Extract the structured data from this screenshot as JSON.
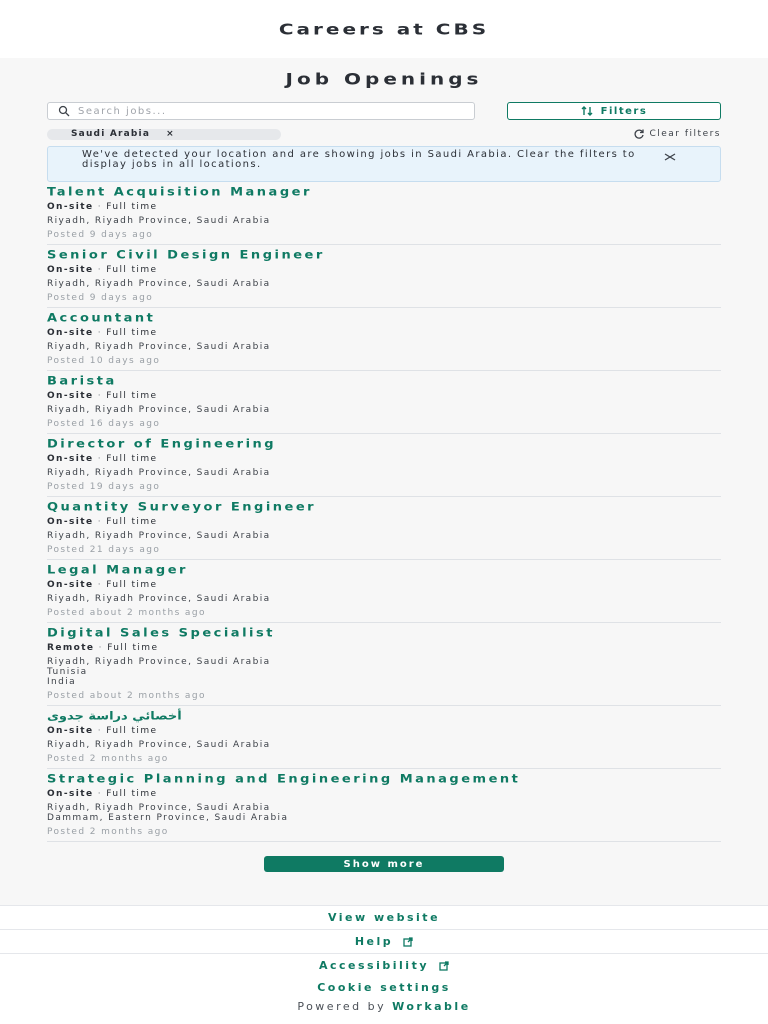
{
  "header": {
    "title": "Careers at CBS"
  },
  "main": {
    "title": "Job Openings",
    "search": {
      "placeholder": "Search jobs..."
    },
    "filters_label": "Filters",
    "filter_chip": {
      "label": "Saudi Arabia",
      "close": "×"
    },
    "clear_filters_label": "Clear filters",
    "notice": {
      "text": "We've detected your location and are showing jobs in Saudi Arabia. Clear the filters to display jobs in all locations."
    },
    "jobs": [
      {
        "title": "Talent Acquisition Manager",
        "workplace": "On-site",
        "type": "Full time",
        "locations": [
          "Riyadh, Riyadh Province, Saudi Arabia"
        ],
        "posted": "Posted 9 days ago"
      },
      {
        "title": "Senior Civil Design Engineer",
        "workplace": "On-site",
        "type": "Full time",
        "locations": [
          "Riyadh, Riyadh Province, Saudi Arabia"
        ],
        "posted": "Posted 9 days ago"
      },
      {
        "title": "Accountant",
        "workplace": "On-site",
        "type": "Full time",
        "locations": [
          "Riyadh, Riyadh Province, Saudi Arabia"
        ],
        "posted": "Posted 10 days ago"
      },
      {
        "title": "Barista",
        "workplace": "On-site",
        "type": "Full time",
        "locations": [
          "Riyadh, Riyadh Province, Saudi Arabia"
        ],
        "posted": "Posted 16 days ago"
      },
      {
        "title": "Director of Engineering",
        "workplace": "On-site",
        "type": "Full time",
        "locations": [
          "Riyadh, Riyadh Province, Saudi Arabia"
        ],
        "posted": "Posted 19 days ago"
      },
      {
        "title": "Quantity Surveyor Engineer",
        "workplace": "On-site",
        "type": "Full time",
        "locations": [
          "Riyadh, Riyadh Province, Saudi Arabia"
        ],
        "posted": "Posted 21 days ago"
      },
      {
        "title": "Legal Manager",
        "workplace": "On-site",
        "type": "Full time",
        "locations": [
          "Riyadh, Riyadh Province, Saudi Arabia"
        ],
        "posted": "Posted about 2 months ago"
      },
      {
        "title": "Digital Sales Specialist",
        "workplace": "Remote",
        "type": "Full time",
        "locations": [
          "Riyadh, Riyadh Province, Saudi Arabia",
          "Tunisia",
          "India"
        ],
        "posted": "Posted about 2 months ago"
      },
      {
        "title": "أخصائي دراسة جدوى",
        "workplace": "On-site",
        "type": "Full time",
        "locations": [
          "Riyadh, Riyadh Province, Saudi Arabia"
        ],
        "posted": "Posted 2 months ago"
      },
      {
        "title": "Strategic Planning and Engineering Management",
        "workplace": "On-site",
        "type": "Full time",
        "locations": [
          "Riyadh, Riyadh Province, Saudi Arabia",
          "Dammam, Eastern Province, Saudi Arabia"
        ],
        "posted": "Posted 2 months ago"
      }
    ],
    "show_more_label": "Show more"
  },
  "footer": {
    "view_website": "View website",
    "help": "Help",
    "accessibility": "Accessibility",
    "cookie_settings": "Cookie settings",
    "powered_by": "Powered by",
    "brand": "Workable"
  },
  "colors": {
    "accent": "#0f7a63",
    "notice_bg": "#e8f3fb"
  },
  "icons": {
    "search": "search-icon",
    "filters": "sort-arrows-icon",
    "clear": "refresh-icon",
    "close": "close-icon",
    "external": "external-link-icon"
  }
}
